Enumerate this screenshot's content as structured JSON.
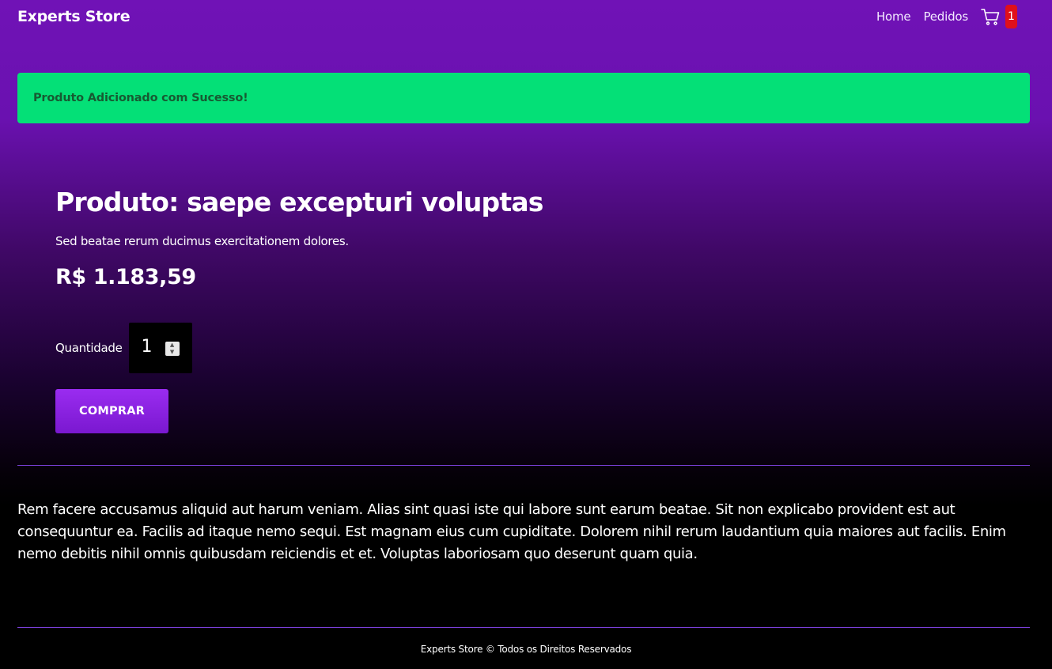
{
  "navbar": {
    "brand": "Experts Store",
    "links": {
      "home": "Home",
      "orders": "Pedidos"
    },
    "cart": {
      "icon": "shopping-cart-icon",
      "count": "1"
    }
  },
  "alert": {
    "message": "Produto Adicionado com Sucesso!",
    "color": "#04e077"
  },
  "product": {
    "title": "Produto: saepe excepturi voluptas",
    "short_description": "Sed beatae rerum ducimus exercitationem dolores.",
    "price": "R$ 1.183,59",
    "quantity_label": "Quantidade",
    "quantity_value": "1",
    "buy_label": "COMPRAR",
    "long_description": "Rem facere accusamus aliquid aut harum veniam. Alias sint quasi iste qui labore sunt earum beatae. Sit non explicabo provident est aut consequuntur ea. Facilis ad itaque nemo sequi. Est magnam eius cum cupiditate. Dolorem nihil rerum laudantium quia maiores aut facilis. Enim nemo debitis nihil omnis quibusdam reiciendis et et. Voluptas laboriosam quo deserunt quam quia."
  },
  "footer": {
    "text": "Experts Store © Todos os Direitos Reservados"
  },
  "colors": {
    "accent": "#7a18d0",
    "badge": "#e0101a",
    "divider": "#7a3fd8"
  }
}
